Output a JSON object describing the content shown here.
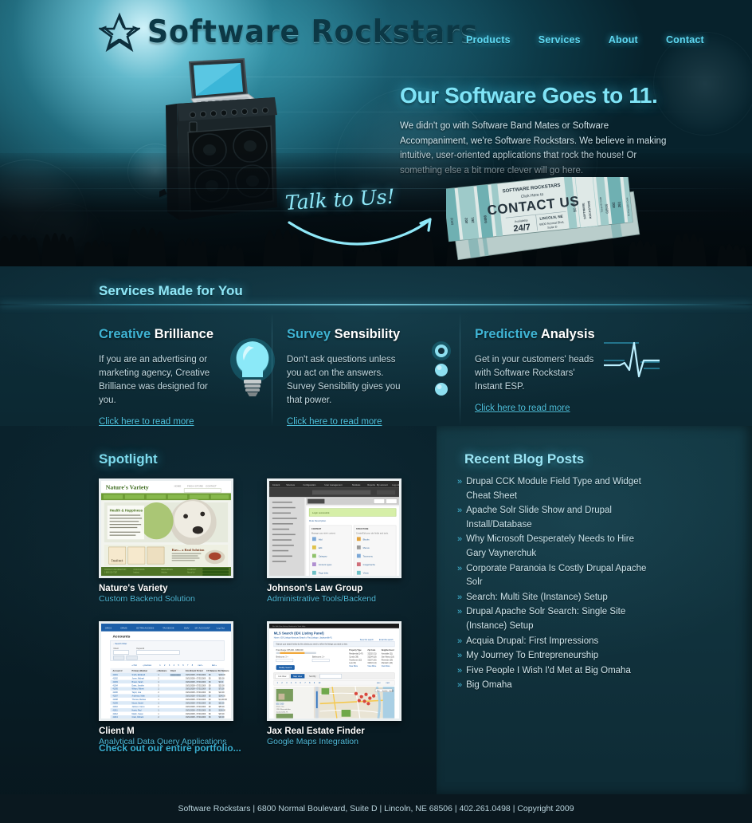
{
  "site": {
    "logo_text": "Software Rockstars",
    "logo_icon": "star-logo-icon"
  },
  "nav": {
    "items": [
      {
        "label": "Products"
      },
      {
        "label": "Services"
      },
      {
        "label": "About"
      },
      {
        "label": "Contact"
      }
    ]
  },
  "hero": {
    "title": "Our Software Goes to 11.",
    "paragraph": "We didn't go with Software Band Mates or Software Accompaniment, we're Software Rockstars. We believe in making intuitive, user-oriented applications that rock the house! Or something else a bit more clever will go here.",
    "talk_text": "Talk to Us!",
    "ticket": {
      "brand": "SOFTWARE ROCKSTARS",
      "click_here": "Click Here to",
      "headline": "CONTACT US",
      "availability_label": "Availability",
      "availability_value": "24/7",
      "city": "LINCOLN, NE",
      "address_line1": "6800 Normal Blvd,",
      "address_line2": "Suite D",
      "stub_price": "$0.00",
      "stub_brand": "SOFTWARE ROCKSTARS",
      "stub_code_label": "Ticket ID Code",
      "stub_code": "68506",
      "stub_expiry": "No Expiration Date",
      "edge_numbers": [
        "0498",
        "261",
        "402",
        "6800"
      ]
    }
  },
  "services": {
    "section_title": "Services Made for You",
    "columns": [
      {
        "heading_highlight": "Creative",
        "heading_rest": "Brilliance",
        "body": "If you are an advertising or marketing agency, Creative Brilliance was designed for you.",
        "link": "Click here to read more",
        "icon": "lightbulb-icon"
      },
      {
        "heading_highlight": "Survey",
        "heading_rest": "Sensibility",
        "body": "Don't ask questions unless you act on the answers. Survey Sensibility gives you that power.",
        "link": "Click here to read more",
        "icon": "radio-buttons-icon"
      },
      {
        "heading_highlight": "Predictive",
        "heading_rest": "Analysis",
        "body": "Get in your customers' heads with Software Rockstars' Instant ESP.",
        "link": "Click here to read more",
        "icon": "waveform-icon"
      }
    ]
  },
  "spotlight": {
    "title": "Spotlight",
    "items": [
      {
        "title": "Nature's Variety",
        "subtitle": "Custom Backend Solution",
        "shot": "natures-variety"
      },
      {
        "title": "Johnson's Law Group",
        "subtitle": "Administrative Tools/Backend",
        "shot": "johnsons-law"
      },
      {
        "title": "Client M",
        "subtitle": "Analytical Data Query Applications",
        "shot": "client-m"
      },
      {
        "title": "Jax Real Estate Finder",
        "subtitle": "Google Maps Integration",
        "shot": "jax-real-estate"
      }
    ],
    "more_link": "Check out our entire portfolio..."
  },
  "blog": {
    "title": "Recent Blog Posts",
    "bullet": "»",
    "posts": [
      {
        "title": "Drupal CCK Module Field Type and Widget Cheat Sheet"
      },
      {
        "title": "Apache Solr Slide Show and Drupal Install/Database"
      },
      {
        "title": "Why Microsoft Desperately Needs to Hire Gary Vaynerchuk"
      },
      {
        "title": "Corporate Paranoia Is Costly Drupal Apache Solr"
      },
      {
        "title": "Search: Multi Site  (Instance) Setup"
      },
      {
        "title": "Drupal Apache Solr Search: Single Site (Instance) Setup"
      },
      {
        "title": "Acquia Drupal: First Impressions"
      },
      {
        "title": "My Journey To Entrepreneurship"
      },
      {
        "title": "Five People I Wish I'd Met at Big Omaha"
      },
      {
        "title": "Big Omaha"
      }
    ]
  },
  "footer": {
    "text": "Software Rockstars | 6800 Normal Boulevard, Suite D | Lincoln, NE 68506 | 402.261.0498 | Copyright 2009"
  },
  "colors": {
    "accent_cyan": "#5fd8f2",
    "heading_cyan": "#7fe4f7",
    "link_cyan": "#4fc4e0",
    "panel_teal": "#133944",
    "footer_bg": "#0a181f",
    "ticket_teal": "#7fc4c6"
  }
}
